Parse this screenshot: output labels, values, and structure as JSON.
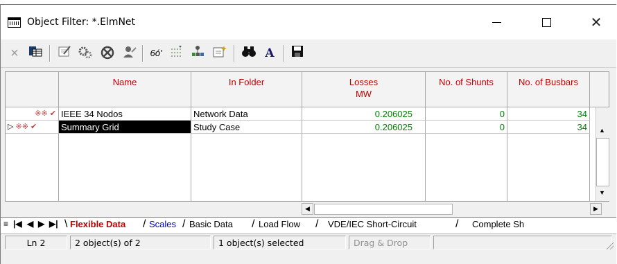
{
  "window": {
    "title": "Object Filter: *.ElmNet",
    "controls": {
      "minimize": "minimize",
      "maximize": "maximize",
      "close": "close"
    }
  },
  "toolbar": {
    "icons": [
      "close-x-icon",
      "table-icon",
      "edit-icon",
      "gears-icon",
      "crossed-circle-icon",
      "user-key-icon",
      "glasses-icon",
      "filter-icon",
      "tree-icon",
      "new-object-icon",
      "binoculars-icon",
      "font-icon",
      "save-icon"
    ]
  },
  "table": {
    "columns": [
      {
        "label": "Name",
        "unit": "",
        "color": "#000000"
      },
      {
        "label": "In Folder",
        "unit": "",
        "color": "#c00000"
      },
      {
        "label": "Losses",
        "unit": "MW",
        "color": "#c00000"
      },
      {
        "label": "No. of Shunts",
        "unit": "",
        "color": "#c00000"
      },
      {
        "label": "No. of Busbars",
        "unit": "",
        "color": "#c00000"
      }
    ],
    "rows": [
      {
        "marker": "",
        "icon": "※※ ✔",
        "name": "IEEE 34 Nodos",
        "folder": "Network Data",
        "losses": "0.206025",
        "shunts": "0",
        "busbars": "34",
        "selected": false
      },
      {
        "marker": "▷",
        "icon": "※※ ✔",
        "name": "Summary Grid",
        "folder": "Study Case",
        "losses": "0.206025",
        "shunts": "0",
        "busbars": "34",
        "selected": true
      }
    ]
  },
  "tabs": {
    "items": [
      "Flexible Data",
      "Scales",
      "Basic Data",
      "Load Flow",
      "VDE/IEC Short-Circuit",
      "Complete Sh"
    ],
    "active": "Flexible Data"
  },
  "status": {
    "line": "Ln 2",
    "objects": "2 object(s) of 2",
    "selected": "1 object(s) selected",
    "drag": "Drag & Drop"
  },
  "colors": {
    "header_red": "#c00000",
    "value_green": "#008000",
    "tab_blue": "#0000c0"
  }
}
